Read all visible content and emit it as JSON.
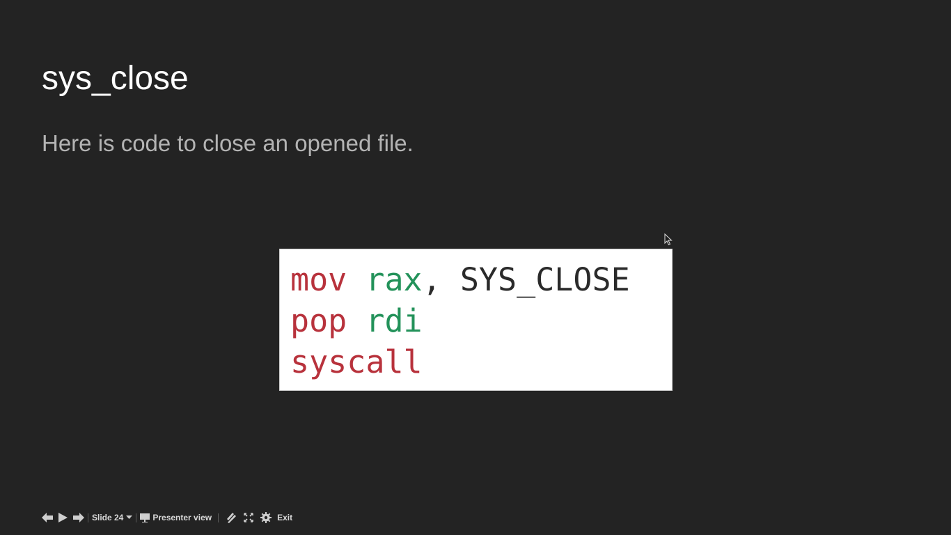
{
  "slide": {
    "title": "sys_close",
    "body": "Here is code to close an opened file.",
    "code": {
      "line1": {
        "kw": "mov",
        "reg": "rax",
        "rest": ", SYS_CLOSE"
      },
      "line2": {
        "kw": "pop",
        "reg": "rdi"
      },
      "line3": {
        "kw": "syscall"
      }
    }
  },
  "controls": {
    "slide_label": "Slide 24",
    "presenter_view": "Presenter view",
    "exit": "Exit",
    "icons": [
      "arrow-left-icon",
      "play-icon",
      "arrow-right-icon",
      "chevron-down-icon",
      "presenter-screen-icon",
      "laser-pointer-icon",
      "fullscreen-icon",
      "gear-icon"
    ]
  },
  "colors": {
    "background": "#232323",
    "keyword": "#b8323c",
    "register": "#23925a",
    "title": "#ffffff",
    "body_text": "#b4b4b4"
  }
}
